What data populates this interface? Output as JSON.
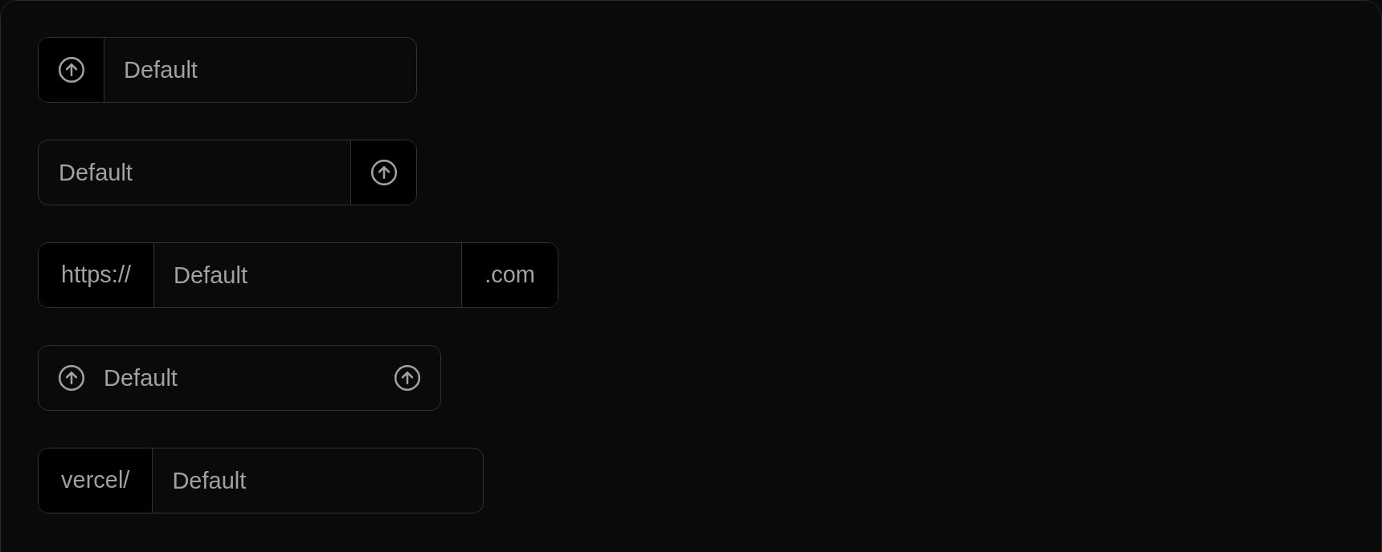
{
  "inputs": [
    {
      "prefix": {
        "kind": "icon"
      },
      "placeholder": "Default"
    },
    {
      "placeholder": "Default",
      "suffix": {
        "kind": "icon"
      }
    },
    {
      "prefix": {
        "kind": "text",
        "text": "https://"
      },
      "placeholder": "Default",
      "suffix": {
        "kind": "text",
        "text": ".com"
      }
    },
    {
      "prefix": {
        "kind": "inline_icon"
      },
      "placeholder": "Default",
      "suffix": {
        "kind": "inline_icon"
      }
    },
    {
      "prefix": {
        "kind": "text",
        "text": "vercel/"
      },
      "placeholder": "Default"
    }
  ]
}
